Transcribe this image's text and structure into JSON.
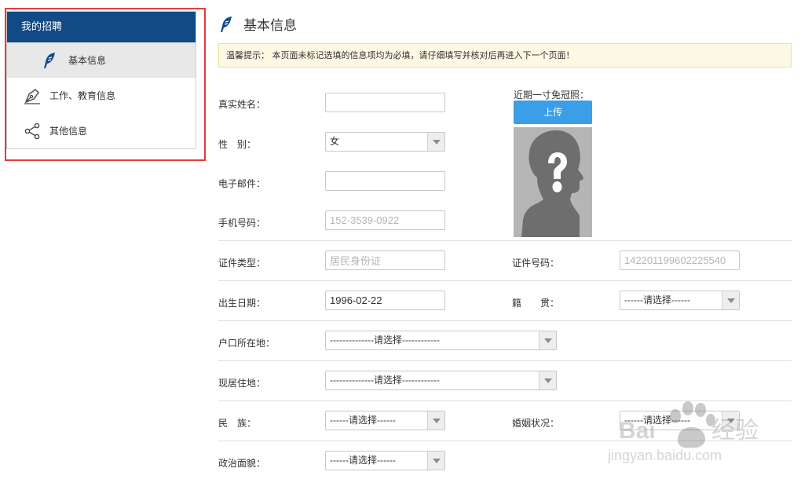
{
  "sidebar": {
    "header": "我的招聘",
    "items": [
      {
        "label": "基本信息",
        "icon": "quill-icon",
        "active": true
      },
      {
        "label": "工作、教育信息",
        "icon": "pen-tool-icon",
        "active": false
      },
      {
        "label": "其他信息",
        "icon": "share-icon",
        "active": false
      }
    ]
  },
  "main": {
    "title": "基本信息",
    "notice": "温馨提示： 本页面未标记选填的信息项均为必填，请仔细填写并核对后再进入下一个页面！",
    "photo": {
      "label": "近期一寸免冠照：",
      "upload_label": "上传",
      "placeholder_icon": "person-question-icon"
    },
    "fields": {
      "name": {
        "label": "真实姓名：",
        "value": ""
      },
      "gender": {
        "label": "性　别：",
        "value": "女"
      },
      "email": {
        "label": "电子邮件：",
        "value": ""
      },
      "phone": {
        "label": "手机号码：",
        "placeholder": "152-3539-0922"
      },
      "id_type": {
        "label": "证件类型：",
        "value": "居民身份证"
      },
      "id_number": {
        "label": "证件号码：",
        "value": "142201199602225540"
      },
      "birth": {
        "label": "出生日期：",
        "value": "1996-02-22"
      },
      "origin": {
        "label": "籍　　贯：",
        "value": "------请选择------"
      },
      "hukou": {
        "label": "户口所在地：",
        "value": "--------------请选择------------"
      },
      "residence": {
        "label": "现居住地：",
        "value": "--------------请选择------------"
      },
      "ethnicity": {
        "label": "民　族：",
        "value": "------请选择------"
      },
      "marital": {
        "label": "婚姻状况：",
        "value": "------请选择------"
      },
      "political": {
        "label": "政治面貌：",
        "value": "------请选择------"
      }
    }
  },
  "watermark": {
    "brand": "Baidu经验",
    "url": "jingyan.baidu.com"
  },
  "colors": {
    "header": "#114a85",
    "upload": "#3a9fe6",
    "notice_bg": "#fcf8e3",
    "highlight_frame": "#e63b3b"
  }
}
